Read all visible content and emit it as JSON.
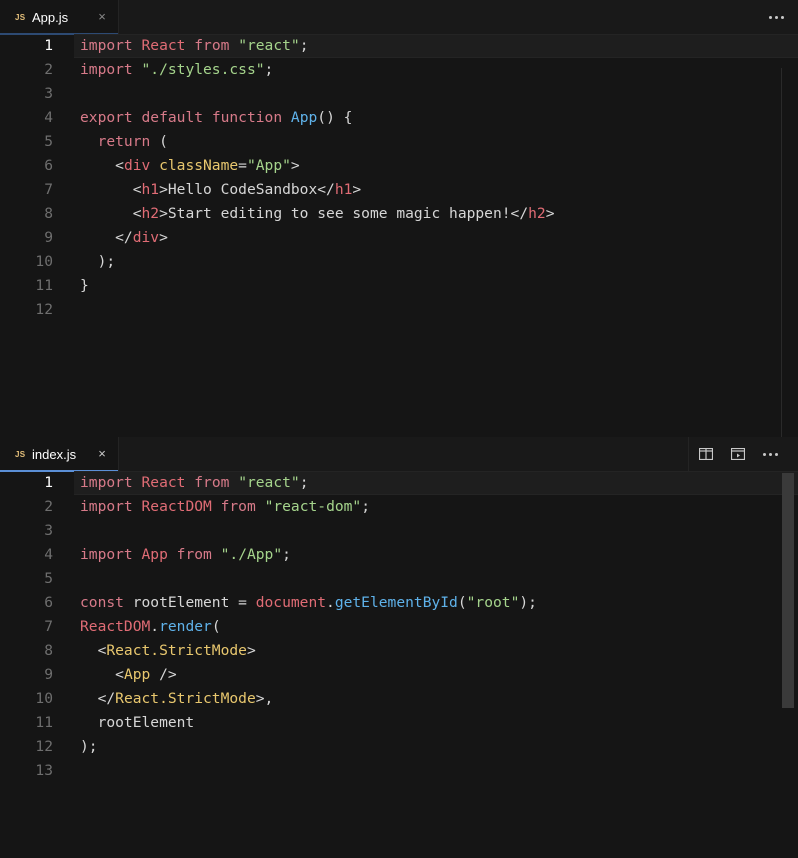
{
  "top_pane": {
    "tab": {
      "icon": "js-file-icon",
      "icon_text": "JS",
      "label": "App.js",
      "close": "×"
    },
    "lines": [
      {
        "n": "1",
        "tokens": [
          [
            "kw",
            "import"
          ],
          [
            "pn",
            " "
          ],
          [
            "tag",
            "React"
          ],
          [
            "pn",
            " "
          ],
          [
            "kw",
            "from"
          ],
          [
            "pn",
            " "
          ],
          [
            "str",
            "\"react\""
          ],
          [
            "pn",
            ";"
          ]
        ]
      },
      {
        "n": "2",
        "tokens": [
          [
            "kw",
            "import"
          ],
          [
            "pn",
            " "
          ],
          [
            "str",
            "\"./styles.css\""
          ],
          [
            "pn",
            ";"
          ]
        ]
      },
      {
        "n": "3",
        "tokens": []
      },
      {
        "n": "4",
        "tokens": [
          [
            "kw",
            "export"
          ],
          [
            "pn",
            " "
          ],
          [
            "kw",
            "default"
          ],
          [
            "pn",
            " "
          ],
          [
            "kw",
            "function"
          ],
          [
            "pn",
            " "
          ],
          [
            "fn",
            "App"
          ],
          [
            "pn",
            "() {"
          ]
        ]
      },
      {
        "n": "5",
        "tokens": [
          [
            "pn",
            "  "
          ],
          [
            "kw",
            "return"
          ],
          [
            "pn",
            " ("
          ]
        ]
      },
      {
        "n": "6",
        "tokens": [
          [
            "pn",
            "    <"
          ],
          [
            "tag",
            "div"
          ],
          [
            "pn",
            " "
          ],
          [
            "attr",
            "className"
          ],
          [
            "pn",
            "="
          ],
          [
            "str",
            "\"App\""
          ],
          [
            "pn",
            ">"
          ]
        ]
      },
      {
        "n": "7",
        "tokens": [
          [
            "pn",
            "      <"
          ],
          [
            "tag",
            "h1"
          ],
          [
            "pn",
            ">Hello CodeSandbox</"
          ],
          [
            "tag",
            "h1"
          ],
          [
            "pn",
            ">"
          ]
        ]
      },
      {
        "n": "8",
        "tokens": [
          [
            "pn",
            "      <"
          ],
          [
            "tag",
            "h2"
          ],
          [
            "pn",
            ">Start editing to see some magic happen!</"
          ],
          [
            "tag",
            "h2"
          ],
          [
            "pn",
            ">"
          ]
        ]
      },
      {
        "n": "9",
        "tokens": [
          [
            "pn",
            "    </"
          ],
          [
            "tag",
            "div"
          ],
          [
            "pn",
            ">"
          ]
        ]
      },
      {
        "n": "10",
        "tokens": [
          [
            "pn",
            "  );"
          ]
        ]
      },
      {
        "n": "11",
        "tokens": [
          [
            "pn",
            "}"
          ]
        ]
      },
      {
        "n": "12",
        "tokens": []
      }
    ]
  },
  "bottom_pane": {
    "tab": {
      "icon": "js-file-icon",
      "icon_text": "JS",
      "label": "index.js",
      "close": "×"
    },
    "actions": [
      "split-editor-icon",
      "open-preview-icon",
      "more-actions-icon"
    ],
    "lines": [
      {
        "n": "1",
        "tokens": [
          [
            "kw",
            "import"
          ],
          [
            "pn",
            " "
          ],
          [
            "tag",
            "React"
          ],
          [
            "pn",
            " "
          ],
          [
            "kw",
            "from"
          ],
          [
            "pn",
            " "
          ],
          [
            "str",
            "\"react\""
          ],
          [
            "pn",
            ";"
          ]
        ]
      },
      {
        "n": "2",
        "tokens": [
          [
            "kw",
            "import"
          ],
          [
            "pn",
            " "
          ],
          [
            "tag",
            "ReactDOM"
          ],
          [
            "pn",
            " "
          ],
          [
            "kw",
            "from"
          ],
          [
            "pn",
            " "
          ],
          [
            "str",
            "\"react-dom\""
          ],
          [
            "pn",
            ";"
          ]
        ]
      },
      {
        "n": "3",
        "tokens": []
      },
      {
        "n": "4",
        "tokens": [
          [
            "kw",
            "import"
          ],
          [
            "pn",
            " "
          ],
          [
            "tag",
            "App"
          ],
          [
            "pn",
            " "
          ],
          [
            "kw",
            "from"
          ],
          [
            "pn",
            " "
          ],
          [
            "str",
            "\"./App\""
          ],
          [
            "pn",
            ";"
          ]
        ]
      },
      {
        "n": "5",
        "tokens": []
      },
      {
        "n": "6",
        "tokens": [
          [
            "kw",
            "const"
          ],
          [
            "pn",
            " rootElement = "
          ],
          [
            "tag",
            "document"
          ],
          [
            "pn",
            "."
          ],
          [
            "fn",
            "getElementById"
          ],
          [
            "pn",
            "("
          ],
          [
            "str",
            "\"root\""
          ],
          [
            "pn",
            ");"
          ]
        ]
      },
      {
        "n": "7",
        "tokens": [
          [
            "tag",
            "ReactDOM"
          ],
          [
            "pn",
            "."
          ],
          [
            "fn",
            "render"
          ],
          [
            "pn",
            "("
          ]
        ]
      },
      {
        "n": "8",
        "tokens": [
          [
            "pn",
            "  <"
          ],
          [
            "cls",
            "React.StrictMode"
          ],
          [
            "pn",
            ">"
          ]
        ]
      },
      {
        "n": "9",
        "tokens": [
          [
            "pn",
            "    <"
          ],
          [
            "cls",
            "App"
          ],
          [
            "pn",
            " />"
          ]
        ]
      },
      {
        "n": "10",
        "tokens": [
          [
            "pn",
            "  </"
          ],
          [
            "cls",
            "React.StrictMode"
          ],
          [
            "pn",
            ">,"
          ]
        ]
      },
      {
        "n": "11",
        "tokens": [
          [
            "pn",
            "  rootElement"
          ]
        ]
      },
      {
        "n": "12",
        "tokens": [
          [
            "pn",
            ");"
          ]
        ]
      },
      {
        "n": "13",
        "tokens": []
      }
    ]
  },
  "colors": {
    "keyword": "#d77a89",
    "string": "#a5d48c",
    "function": "#5fb2ea",
    "tag": "#e06c75",
    "component": "#e8c76e",
    "tab_accent": "#5b8fd6"
  }
}
